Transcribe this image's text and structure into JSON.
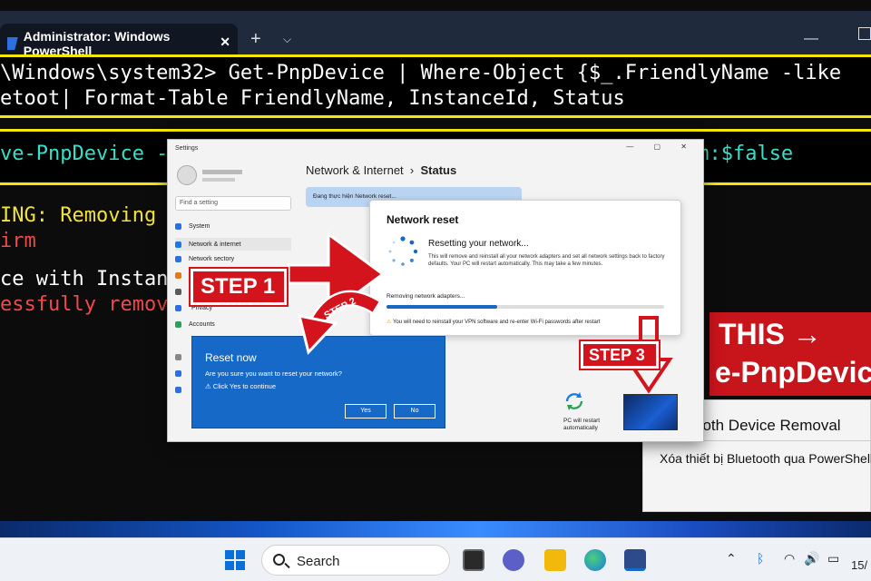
{
  "terminal": {
    "tab_title": "Administrator: Windows PowerShell",
    "close_glyph": "✕",
    "new_tab_glyph": "+",
    "dropdown_glyph": "⌵",
    "minimize_glyph": "—",
    "lines": {
      "cmd1a": "\\Windows\\system32> Get-PnpDevice | Where-Object {$_.FriendlyName -like",
      "cmd1b": "etoot| Format-Table FriendlyName, InstanceId, Status",
      "cmd2": "ve-PnpDevice -I                                        firm:$false",
      "warn1": "ING: Removing de",
      "warn2": "irm",
      "out1": "ce with Instanc",
      "out2": "essfully removed"
    }
  },
  "settings": {
    "window_title": "Settings",
    "window_controls": "—  ▢  ✕",
    "search_placeholder": "Find a setting",
    "nav": [
      "System",
      "Network & internet",
      "Network sectory",
      "",
      "",
      "",
      "Privacy",
      "Accounts"
    ],
    "breadcrumb_parent": "Network & Internet",
    "breadcrumb_sep": "›",
    "breadcrumb_current": "Status",
    "info_banner": "Đang thực hiện Network reset...",
    "network_reset": {
      "title": "Network reset",
      "status": "Resetting your network...",
      "description": "This will remove and reinstall all your network adapters and set all network settings back to factory defaults. Your PC will restart automatically. This may take a few minutes.",
      "progress_label": "Removing network adapters...",
      "progress": 0.4,
      "note": "You will need to reinstall your VPN software and re-enter Wi-Fi passwords after restart"
    },
    "dialog": {
      "title": "Reset now",
      "question": "Are you sure you want to reset your network?",
      "hint": "⚠ Click Yes to continue",
      "yes": "Yes",
      "no": "No"
    },
    "restart_caption": "PC will restart automatically"
  },
  "steps": {
    "step1": "STEP 1",
    "step2": "STEP 2",
    "step3": "STEP 3"
  },
  "banner": {
    "line1": "THIS →",
    "line2": "e-PnpDevice"
  },
  "card": {
    "title": "ooth Device Removal",
    "subtitle": "Xóa thiết bị Bluetooth qua PowerShell"
  },
  "taskbar": {
    "search_label": "Search",
    "tray_chevron": "⌃",
    "tray_bluetooth": "ᛒ",
    "tray_network": "◠",
    "tray_sound": "🔊",
    "tray_battery": "▭",
    "clock": "15/"
  },
  "colors": {
    "accent": "#1769c8",
    "step_red": "#d4141c",
    "highlight_yellow": "#f5e60a"
  }
}
